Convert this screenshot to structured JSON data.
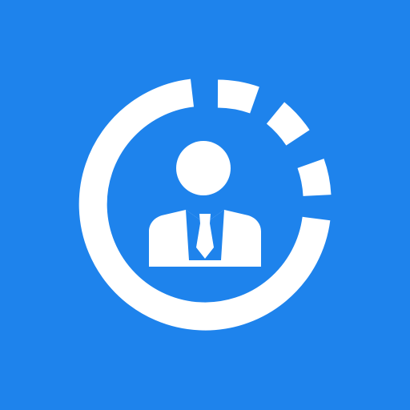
{
  "app_icon": {
    "background_color": "#1e83ec",
    "foreground_color": "#ffffff",
    "icon_name": "user-progress-ring-icon",
    "parts": {
      "ring": "progress-ring-icon",
      "person": "businessman-icon",
      "head": "person-head-icon",
      "suit": "suit-jacket-icon",
      "shirt": "shirt-collar-icon",
      "tie": "necktie-icon"
    }
  }
}
